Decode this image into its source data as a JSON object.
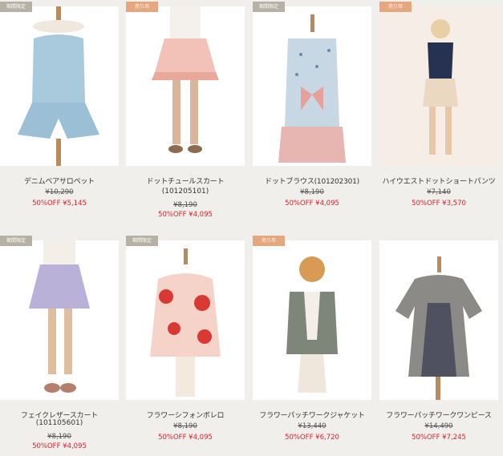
{
  "products": [
    {
      "tag": "期間限定",
      "name": "デニムベアサロペット",
      "code": "",
      "old_price": "¥10,290",
      "sale": "50%OFF ¥5,145"
    },
    {
      "tag": "売り尽",
      "name": "ドットチュールスカート",
      "code": "(101205101)",
      "old_price": "¥8,190",
      "sale": "50%OFF ¥4,095"
    },
    {
      "tag": "期間限定",
      "name": "ドットブラウス(101202301)",
      "code": "",
      "old_price": "¥8,190",
      "sale": "50%OFF ¥4,095"
    },
    {
      "tag": "売り尽",
      "name": "ハイウエストドットショートパンツ",
      "code": "",
      "old_price": "¥7,140",
      "sale": "50%OFF ¥3,570"
    },
    {
      "tag": "期間限定",
      "name": "フェイクレザースカート",
      "code": "(101105601)",
      "old_price": "¥8,190",
      "sale": "50%OFF ¥4,095"
    },
    {
      "tag": "期間限定",
      "name": "フラワーシフォンボレロ",
      "code": "",
      "old_price": "¥8,190",
      "sale": "50%OFF ¥4,095"
    },
    {
      "tag": "売り尽",
      "name": "フラワーパッチワークジャケット",
      "code": "",
      "old_price": "¥13,440",
      "sale": "50%OFF ¥6,720"
    },
    {
      "tag": "",
      "name": "フラワーパッチワークワンピース",
      "code": "",
      "old_price": "¥14,490",
      "sale": "50%OFF ¥7,245"
    }
  ],
  "colors": {
    "sale": "#e0202a",
    "tag_gray": "#b7b0a4",
    "tag_orange": "#e6a77f",
    "background": "#f1efec"
  }
}
